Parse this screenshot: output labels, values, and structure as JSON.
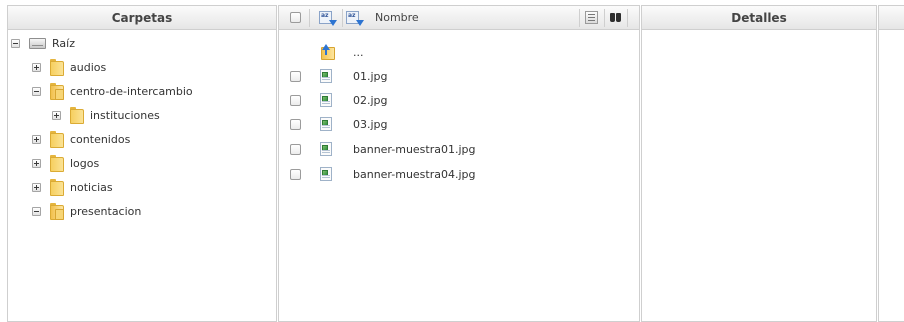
{
  "folders_panel": {
    "title": "Carpetas",
    "tree": [
      {
        "label": "Raíz",
        "icon": "drive-icon",
        "toggle": "collapse",
        "depth": 0
      },
      {
        "label": "audios",
        "icon": "folder-icon",
        "toggle": "expand",
        "depth": 1
      },
      {
        "label": "centro-de-intercambio",
        "icon": "folder-open-icon",
        "toggle": "collapse",
        "depth": 1
      },
      {
        "label": "instituciones",
        "icon": "folder-icon",
        "toggle": "expand",
        "depth": 2
      },
      {
        "label": "contenidos",
        "icon": "folder-icon",
        "toggle": "expand",
        "depth": 1
      },
      {
        "label": "logos",
        "icon": "folder-icon",
        "toggle": "expand",
        "depth": 1
      },
      {
        "label": "noticias",
        "icon": "folder-icon",
        "toggle": "expand",
        "depth": 1
      },
      {
        "label": "presentacion",
        "icon": "folder-open-icon",
        "toggle": "collapse",
        "depth": 1
      }
    ]
  },
  "files_panel": {
    "column_label": "Nombre",
    "parent_entry": "...",
    "files": [
      {
        "name": "01.jpg",
        "icon": "image-file-icon"
      },
      {
        "name": "02.jpg",
        "icon": "image-file-icon"
      },
      {
        "name": "03.jpg",
        "icon": "image-file-icon"
      },
      {
        "name": "banner-muestra01.jpg",
        "icon": "image-file-icon"
      },
      {
        "name": "banner-muestra04.jpg",
        "icon": "image-file-icon"
      }
    ]
  },
  "details_panel": {
    "title": "Detalles"
  }
}
